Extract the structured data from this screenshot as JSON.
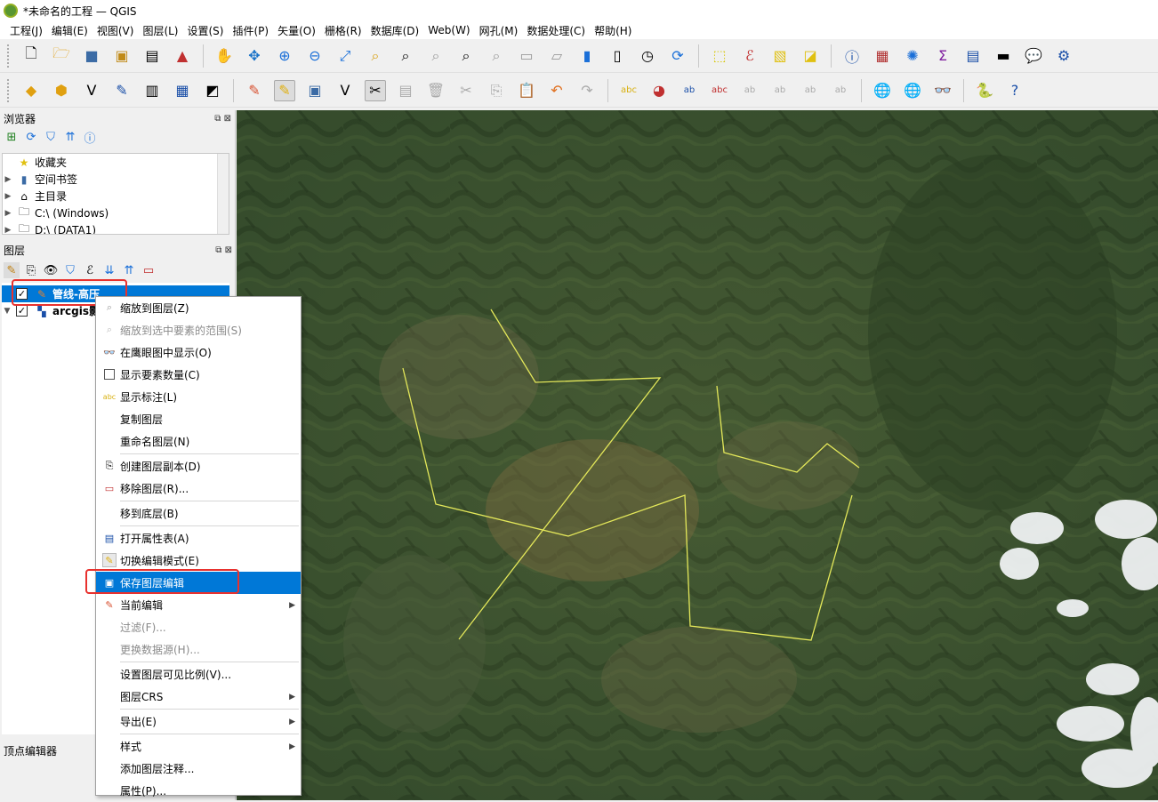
{
  "window": {
    "title": "*未命名的工程 — QGIS"
  },
  "menu": [
    "工程(J)",
    "编辑(E)",
    "视图(V)",
    "图层(L)",
    "设置(S)",
    "插件(P)",
    "矢量(O)",
    "栅格(R)",
    "数据库(D)",
    "Web(W)",
    "网孔(M)",
    "数据处理(C)",
    "帮助(H)"
  ],
  "browser": {
    "title": "浏览器",
    "items": [
      "收藏夹",
      "空间书签",
      "主目录",
      "C:\\ (Windows)",
      "D:\\ (DATA1)"
    ]
  },
  "layers": {
    "title": "图层",
    "items": [
      {
        "name": "管线-高压",
        "checked": true
      },
      {
        "name": "arcgis影",
        "checked": true
      }
    ]
  },
  "vertex_editor": {
    "title": "顶点编辑器"
  },
  "context_menu": {
    "items": [
      {
        "label": "缩放到图层(Z)",
        "icon": "zoom-layer-icon",
        "disabled": false
      },
      {
        "label": "缩放到选中要素的范围(S)",
        "icon": "zoom-selection-icon",
        "disabled": true
      },
      {
        "label": "在鹰眼图中显示(O)",
        "icon": "overview-icon",
        "disabled": false
      },
      {
        "label": "显示要素数量(C)",
        "icon": "checkbox-icon",
        "disabled": false
      },
      {
        "label": "显示标注(L)",
        "icon": "label-icon",
        "disabled": false
      },
      {
        "label": "复制图层",
        "icon": "",
        "disabled": false
      },
      {
        "label": "重命名图层(N)",
        "icon": "",
        "disabled": false,
        "sep_after": true
      },
      {
        "label": "创建图层副本(D)",
        "icon": "duplicate-icon",
        "disabled": false
      },
      {
        "label": "移除图层(R)...",
        "icon": "remove-layer-icon",
        "disabled": false,
        "sep_after": true
      },
      {
        "label": "移到底层(B)",
        "icon": "",
        "disabled": false,
        "sep_after": true
      },
      {
        "label": "打开属性表(A)",
        "icon": "table-icon",
        "disabled": false
      },
      {
        "label": "切换编辑模式(E)",
        "icon": "pencil-icon",
        "disabled": false
      },
      {
        "label": "保存图层编辑",
        "icon": "save-edits-icon",
        "disabled": false,
        "selected": true
      },
      {
        "label": "当前编辑",
        "icon": "edit-pencil-icon",
        "disabled": false,
        "submenu": true
      },
      {
        "label": "过滤(F)...",
        "icon": "",
        "disabled": true
      },
      {
        "label": "更换数据源(H)...",
        "icon": "",
        "disabled": true,
        "sep_after": true
      },
      {
        "label": "设置图层可见比例(V)...",
        "icon": "",
        "disabled": false
      },
      {
        "label": "图层CRS",
        "icon": "",
        "disabled": false,
        "submenu": true,
        "sep_after": true
      },
      {
        "label": "导出(E)",
        "icon": "",
        "disabled": false,
        "submenu": true,
        "sep_after": true
      },
      {
        "label": "样式",
        "icon": "",
        "disabled": false,
        "submenu": true
      },
      {
        "label": "添加图层注释...",
        "icon": "",
        "disabled": false
      },
      {
        "label": "属性(P)...",
        "icon": "",
        "disabled": false
      }
    ]
  },
  "colors": {
    "highlight": "#e8312e",
    "selection": "#0078d7",
    "pipeline": "#e4e85a"
  }
}
